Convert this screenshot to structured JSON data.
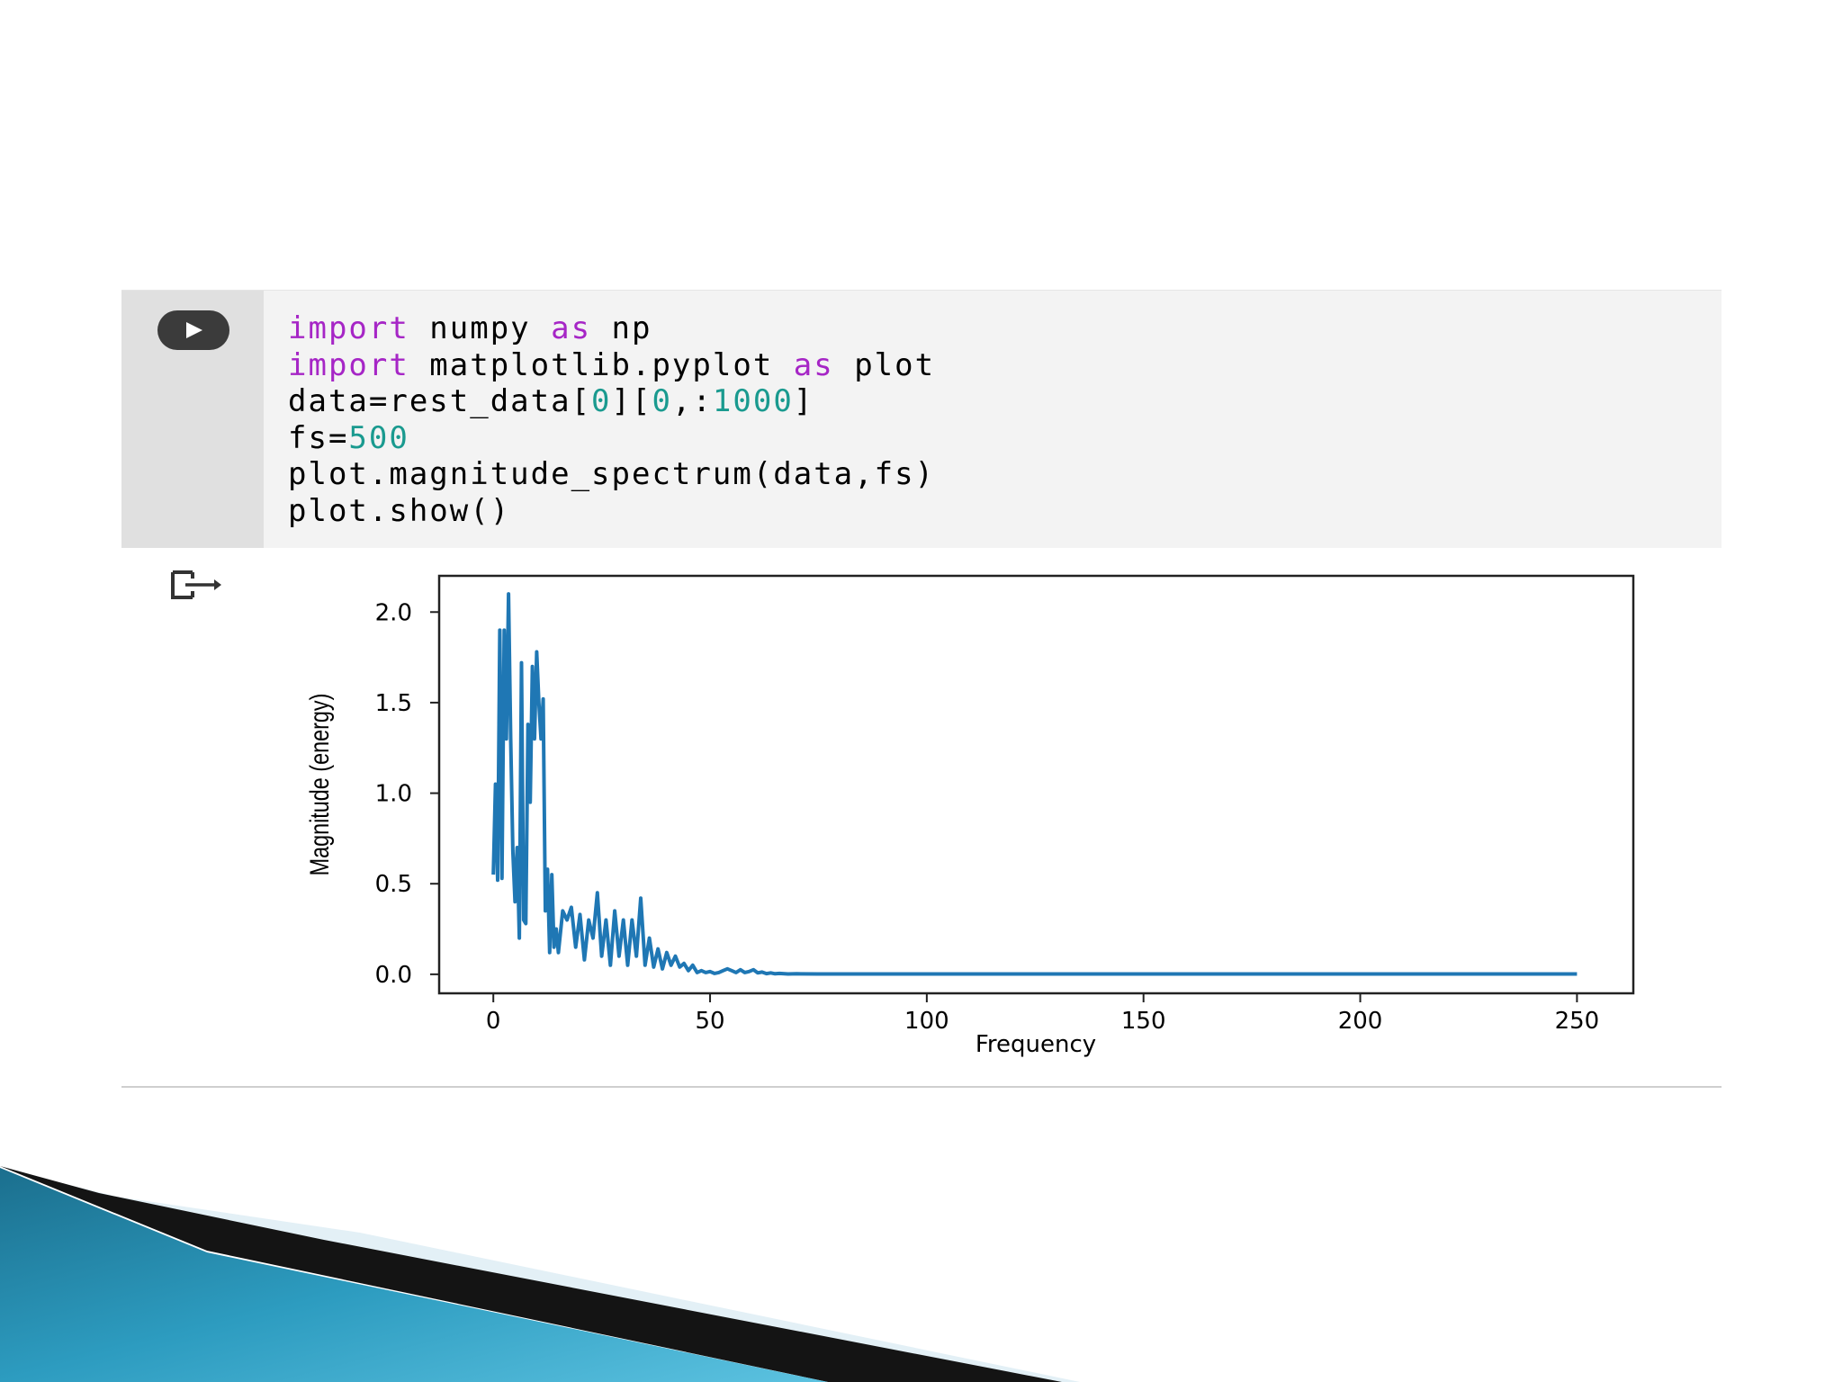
{
  "code_cell": {
    "lines": [
      [
        {
          "t": "import",
          "c": "kw"
        },
        {
          "t": " numpy ",
          "c": ""
        },
        {
          "t": "as",
          "c": "kw"
        },
        {
          "t": " np",
          "c": ""
        }
      ],
      [
        {
          "t": "import",
          "c": "kw"
        },
        {
          "t": " matplotlib.pyplot ",
          "c": ""
        },
        {
          "t": "as",
          "c": "kw"
        },
        {
          "t": " plot",
          "c": ""
        }
      ],
      [
        {
          "t": "data=rest_data[",
          "c": ""
        },
        {
          "t": "0",
          "c": "num"
        },
        {
          "t": "][",
          "c": ""
        },
        {
          "t": "0",
          "c": "num"
        },
        {
          "t": ",:",
          "c": ""
        },
        {
          "t": "1000",
          "c": "num"
        },
        {
          "t": "]",
          "c": ""
        }
      ],
      [
        {
          "t": "fs=",
          "c": ""
        },
        {
          "t": "500",
          "c": "num"
        }
      ],
      [
        {
          "t": "plot.magnitude_spectrum(data,fs)",
          "c": ""
        }
      ],
      [
        {
          "t": "plot.show()",
          "c": ""
        }
      ]
    ],
    "run_icon": "play-icon"
  },
  "output": {
    "icon": "output-arrow-icon"
  },
  "colors": {
    "keyword": "#a626c6",
    "number": "#1a9a8f",
    "line": "#1f77b4",
    "gutter": "#e0e0e0",
    "cell_bg": "#f3f3f3"
  },
  "chart_data": {
    "type": "line",
    "xlabel": "Frequency",
    "ylabel": "Magnitude (energy)",
    "xlim": [
      -12.5,
      263
    ],
    "ylim": [
      -0.105,
      2.2
    ],
    "xticks": [
      0,
      50,
      100,
      150,
      200,
      250
    ],
    "xtick_labels": [
      "0",
      "50",
      "100",
      "150",
      "200",
      "250"
    ],
    "yticks": [
      0.0,
      0.5,
      1.0,
      1.5,
      2.0
    ],
    "ytick_labels": [
      "0.0",
      "0.5",
      "1.0",
      "1.5",
      "2.0"
    ],
    "grid": false,
    "series": [
      {
        "x": [
          0,
          0.5,
          1,
          1.5,
          2,
          2.5,
          3,
          3.5,
          4,
          4.5,
          5,
          5.5,
          6,
          6.5,
          7,
          7.5,
          8,
          8.5,
          9,
          9.5,
          10,
          10.5,
          11,
          11.5,
          12,
          12.5,
          13,
          13.5,
          14,
          14.5,
          15,
          16,
          17,
          18,
          19,
          20,
          21,
          22,
          23,
          24,
          25,
          26,
          27,
          28,
          29,
          30,
          31,
          32,
          33,
          34,
          35,
          36,
          37,
          38,
          39,
          40,
          41,
          42,
          43,
          44,
          45,
          46,
          47,
          48,
          49,
          50,
          51,
          52,
          53,
          54,
          55,
          56,
          57,
          58,
          59,
          60,
          61,
          62,
          63,
          64,
          65,
          66,
          68,
          70,
          75,
          80,
          100,
          150,
          200,
          250
        ],
        "y": [
          0.55,
          1.05,
          0.52,
          1.9,
          0.53,
          1.9,
          1.3,
          2.1,
          1.3,
          0.68,
          0.4,
          0.7,
          0.2,
          1.72,
          0.3,
          0.28,
          1.38,
          0.95,
          1.7,
          1.3,
          1.78,
          1.5,
          1.3,
          1.52,
          0.35,
          0.58,
          0.12,
          0.55,
          0.15,
          0.25,
          0.12,
          0.35,
          0.3,
          0.37,
          0.15,
          0.33,
          0.08,
          0.3,
          0.2,
          0.45,
          0.1,
          0.3,
          0.05,
          0.35,
          0.1,
          0.3,
          0.05,
          0.3,
          0.1,
          0.42,
          0.05,
          0.2,
          0.04,
          0.14,
          0.03,
          0.12,
          0.05,
          0.1,
          0.04,
          0.06,
          0.02,
          0.05,
          0.01,
          0.02,
          0.01,
          0.015,
          0.005,
          0.01,
          0.02,
          0.03,
          0.02,
          0.01,
          0.025,
          0.01,
          0.015,
          0.025,
          0.008,
          0.012,
          0.004,
          0.008,
          0.003,
          0.005,
          0.002,
          0.003,
          0.002,
          0.002,
          0.002,
          0.002,
          0.002,
          0.002
        ]
      }
    ]
  }
}
